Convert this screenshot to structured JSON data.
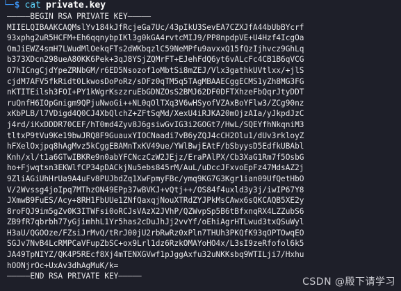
{
  "prompt": {
    "corner": "└─",
    "symbol": "$",
    "command": "cat",
    "argument": "private.key"
  },
  "output_lines": [
    "—————BEGIN RSA PRIVATE KEY—————",
    "MIIELQIBAAKCAQMslYv184kJfRcjeGa7Uc/43pIkU3SevEA7CZXJfA44bUbBYcrf",
    "93xphg2uR5HCFM+Eh6qqnybpIKl3g0kGA4rvtcMIJ9/PP8npdpVE+U4Hzf4IcgOa",
    "OmJiEWZ4smH7LWudMlOekqFTs2dWKbqzlC59NeMPfu9avxxQ15fQzIjhvcz9GhLq",
    "b373XDcn298ueA80KK6Pek+3qJ8YSjZQMrFT+EJehFdQ6yt6vALcFc4CB1B6qVCG",
    "O7hICngCjdYpeZRNbGM/r6ED5Nsozof1oMbtSi8mZEJ/Vlx3gathkUVtlxx/+jlS",
    "cjdM7AFV5fkRidt0LkwosDoPoRz/sDFz0qTM5q5TAgMBAAECggECMS1yZh8MG3FG",
    "nKTITEilsh3FOI+PY1kWgrKszzruEbGDNZOsS2BMJ62DF0DFTXhzeFbQqrJtyDDT",
    "ruQnfH6IOpGnigm9QPjuNwoGi++NL0qOlTXq3V6wHSyofVZAxBoYFlw3/ZCg90nz",
    "xKbPLB/l7VDigd4Q0CJ4XbQlchZ+ZFtSqMd/XexU4iRJKA20mOjzAIa/yJkpdJzC",
    "j4rd/iKxDDDR70CEF/hT0md4Zyv8J6gsiwGvIG3i2GOGt7/HwL/SQEYfhNkqniM3",
    "tltxP9tVu9Ke19bwJRQ8F9GuauxYIOCNaadi7vB6yZQJ4cCH2Olu1/dUv3rkloyZ",
    "hFXelOxjpq8hAgMvz5kCggEBAMnTxKV49ue/YWlBwjEAtF/bSbyysD5EdfkUBAbl",
    "Knh/xl/t1a6GTwIBKRe9n0abYFCNczCzW2JEjz/EraPAlPX/Cb3XaG1Rm7f5OsbG",
    "ho+Fjwqtsn3EKWlfCP34pDACkjNu5ebs845rM/AuL/uDccJFxvoEpFz47MdsAZ2j",
    "9ZliAGiUhHrUa9A4uFv8PUJbdZq1XwFpmyFBc/ymq9KG7G3Kgr1ian09UfQetHbO",
    "V/2Wvssg4joIpq7MThzON49EPp37wBVKJ+vQtj++/OS84f4uxld3y3j/iwIP67Y8",
    "JXmwB9FuES/Acy+8RH1FbUUe1ZNfQaxqjNouXTRdZYJPkMsCAwx6sQKCAQB5XE2y",
    "8roFQJ9im5gZv0K3ITWFsi0oRCJsVAzX2JVhP/QZWvpSp5B6tBfxnqRX4LZZubS6",
    "ZB9fR7qbrbh77yGjimhhL1Yr5has2cDuJhJj2vvYf/oEhiAgrHTLwud3txQSuWyl",
    "H3aU/QGOOze/FZsiJrMvQ/tRrJ00jU2rbRwRz0xPln7THUh3PKQfK93qOPTOwqEO",
    "SGJv7NvB4LcRMPCaVFupZbSC+ox9Lrl1dz6RzkOMAYoHO4x/L3sI9zeRfofol6k5",
    "JA49TpNIYZ/QK4P5REcf8Xj4mTENXGVwf1pJggAxfu32uNKKsbq9WTILji7/Hxhu",
    "hOONjrOc+UxAv3dhAgMuK/k=",
    "—————END RSA PRIVATE KEY—————"
  ],
  "watermark": "CSDN @殿下请学习",
  "colors": {
    "background": "#1e1f29",
    "prompt_blue": "#3b8eea",
    "command_cyan": "#5fd7ff",
    "text": "#e8e8ea"
  }
}
